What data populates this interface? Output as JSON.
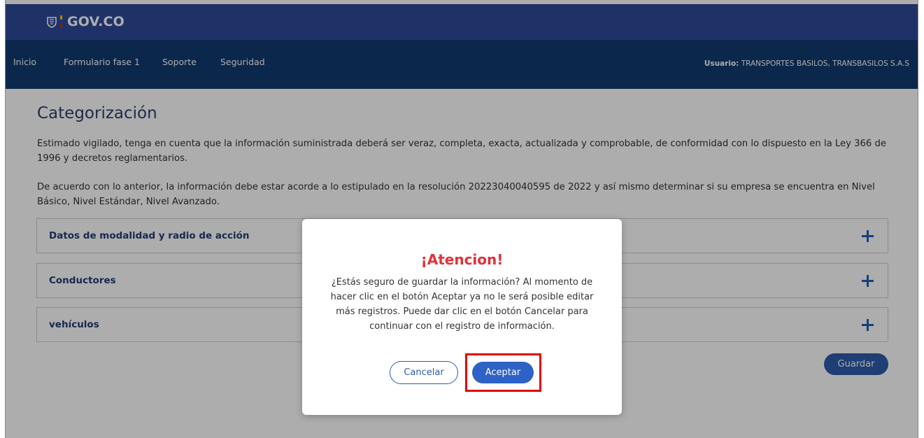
{
  "header": {
    "logo_text": "GOV.CO"
  },
  "nav": {
    "items": [
      {
        "label": "Inicio"
      },
      {
        "label": "Formulario fase 1"
      },
      {
        "label": "Soporte"
      },
      {
        "label": "Seguridad"
      }
    ],
    "user_label": "Usuario:",
    "user_value": "TRANSPORTES BASILOS, TRANSBASILOS S.A.S"
  },
  "page": {
    "title": "Categorización",
    "paragraph1": "Estimado vigilado, tenga en cuenta que la información suministrada deberá ser veraz, completa, exacta, actualizada y comprobable, de conformidad con lo dispuesto en la Ley 366 de 1996 y decretos reglamentarios.",
    "paragraph2": "De acuerdo con lo anterior, la información debe estar acorde a lo estipulado en la resolución 20223040040595 de 2022 y así mismo determinar si su empresa se encuentra en Nivel Básico, Nivel Estándar, Nivel Avanzado.",
    "sections": [
      {
        "label": "Datos de modalidad y radio de acción"
      },
      {
        "label": "Conductores"
      },
      {
        "label": "vehículos"
      }
    ],
    "save_label": "Guardar"
  },
  "modal": {
    "title": "¡Atencion!",
    "body": "¿Estás seguro de guardar la información? Al momento de hacer clic en el botón Aceptar ya no le será posible editar más registros. Puede dar clic en el botón Cancelar para continuar con el registro de información.",
    "cancel_label": "Cancelar",
    "accept_label": "Aceptar"
  },
  "colors": {
    "topbar": "#2e4a9a",
    "navbar": "#113a6f",
    "accent": "#2d5cab",
    "alert": "#e0323a",
    "highlight": "#e3000f"
  }
}
